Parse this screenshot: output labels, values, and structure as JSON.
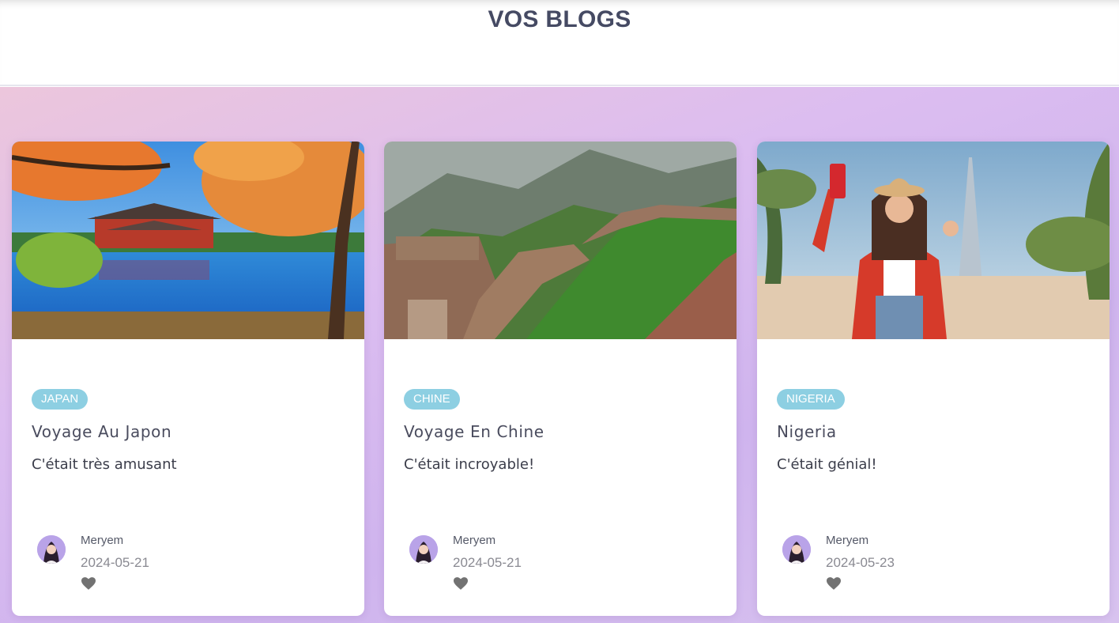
{
  "page": {
    "title": "VOS BLOGS"
  },
  "blogs": [
    {
      "image": "japanese-temple-lake-autumn",
      "tag": "JAPAN",
      "title": "Voyage Au Japon",
      "description": "C'était très amusant",
      "author": "Meryem",
      "date": "2024-05-21",
      "icon": "heart-icon"
    },
    {
      "image": "great-wall-of-china",
      "tag": "CHINE",
      "title": "Voyage En Chine",
      "description": "C'était incroyable!",
      "author": "Meryem",
      "date": "2024-05-21",
      "icon": "heart-icon"
    },
    {
      "image": "woman-selfie-city-palms",
      "tag": "NIGERIA",
      "title": "Nigeria",
      "description": "C'était génial!",
      "author": "Meryem",
      "date": "2024-05-23",
      "icon": "heart-icon"
    }
  ],
  "colors": {
    "title": "#454a63",
    "tag_bg": "#8dcfe2",
    "background_gradient_start": "#ecc6dc",
    "background_gradient_end": "#cfb4ee"
  }
}
